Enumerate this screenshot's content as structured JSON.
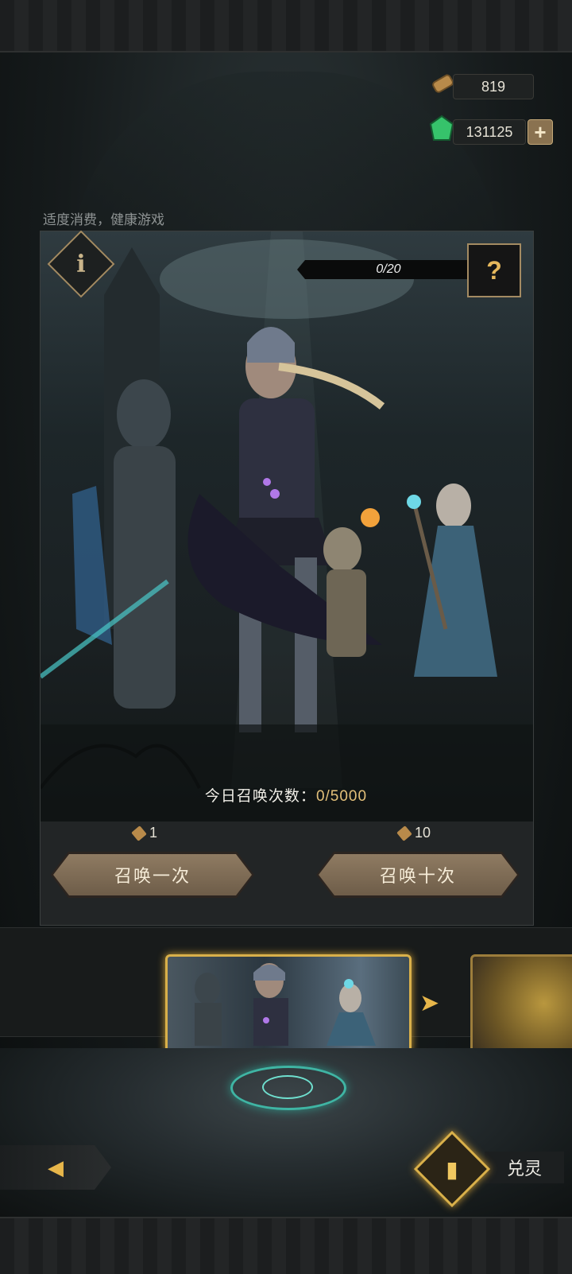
{
  "resources": {
    "scroll_count": "819",
    "gem_count": "131125",
    "plus_glyph": "+"
  },
  "notice": "适度消费，健康游戏",
  "banner": {
    "info_glyph": "i",
    "progress": "0/20",
    "reward_glyph": "?",
    "daily_label": "今日召唤次数：",
    "daily_value": "0/5000"
  },
  "summon": {
    "single": {
      "cost": "1",
      "label": "召唤一次"
    },
    "ten": {
      "cost": "10",
      "label": "召唤十次"
    }
  },
  "carousel": {
    "next_glyph": "➤"
  },
  "bottom": {
    "back_glyph": "◀",
    "exchange_label": "兑灵",
    "exchange_glyph": "▮"
  },
  "colors": {
    "accent_gold": "#d9b04a",
    "rune_teal": "#3fb5a4",
    "button_brown": "#8f7b62"
  }
}
